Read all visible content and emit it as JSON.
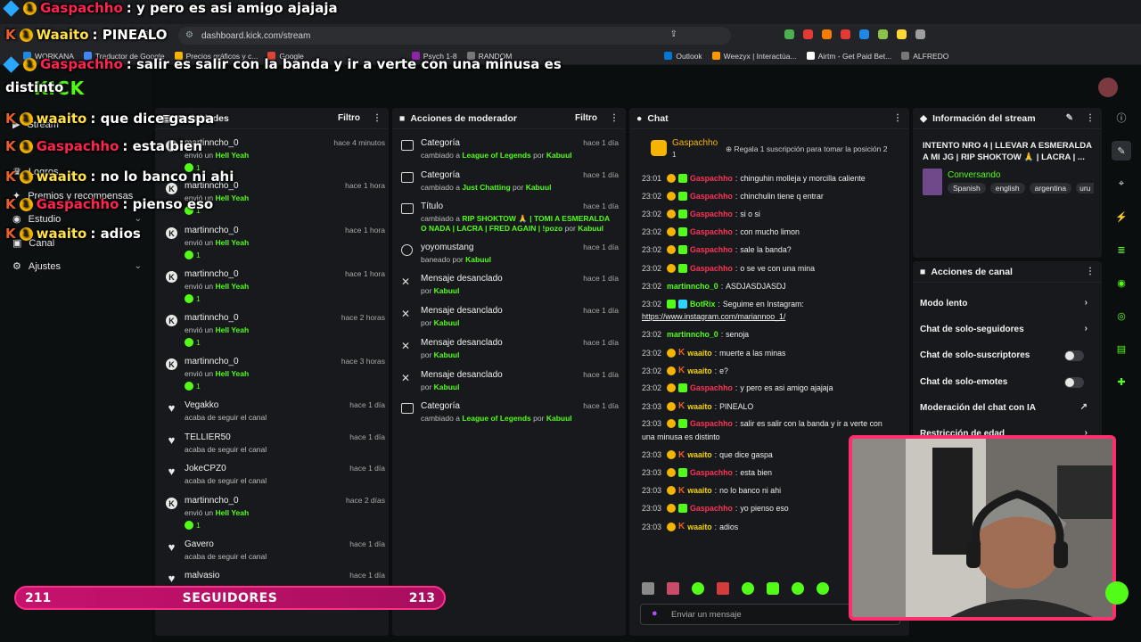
{
  "browser": {
    "url": "dashboard.kick.com/stream",
    "bookmarks": [
      "WORKANA",
      "Traductor de Google",
      "Precios gráficos y c...",
      "Google",
      "Psych 1-8",
      "RANDOM",
      "Outlook",
      "Weezyx | Interactúa...",
      "Airtm - Get Paid Bet...",
      "ALFREDO"
    ]
  },
  "sidebar": {
    "logo": "KICK",
    "items": [
      {
        "label": "Stream"
      },
      {
        "label": "Logros"
      },
      {
        "label": "Premios y recompensas"
      },
      {
        "label": "Estudio"
      },
      {
        "label": "Canal"
      },
      {
        "label": "Ajustes"
      }
    ]
  },
  "activity": {
    "title": "Actividades",
    "filter": "Filtro",
    "rows": [
      {
        "name": "martinncho_0",
        "pre": "envió un",
        "item": "Hell Yeah",
        "time": "hace 4 minutos",
        "count": "1"
      },
      {
        "name": "martinncho_0",
        "pre": "envió un",
        "item": "Hell Yeah",
        "time": "hace 1 hora",
        "count": "1"
      },
      {
        "name": "martinncho_0",
        "pre": "envió un",
        "item": "Hell Yeah",
        "time": "hace 1 hora",
        "count": "1"
      },
      {
        "name": "martinncho_0",
        "pre": "envió un",
        "item": "Hell Yeah",
        "time": "hace 1 hora",
        "count": "1"
      },
      {
        "name": "martinncho_0",
        "pre": "envió un",
        "item": "Hell Yeah",
        "time": "hace 2 horas",
        "count": "1"
      },
      {
        "name": "martinncho_0",
        "pre": "envió un",
        "item": "Hell Yeah",
        "time": "hace 3 horas",
        "count": "1"
      },
      {
        "name": "Vegakko",
        "sub": "acaba de seguir el canal",
        "time": "hace 1 día"
      },
      {
        "name": "TELLIER50",
        "sub": "acaba de seguir el canal",
        "time": "hace 1 día"
      },
      {
        "name": "JokeCPZ0",
        "sub": "acaba de seguir el canal",
        "time": "hace 1 día"
      },
      {
        "name": "martinncho_0",
        "pre": "envió un",
        "item": "Hell Yeah",
        "time": "hace 2 días",
        "count": "1"
      },
      {
        "name": "Gavero",
        "sub": "acaba de seguir el canal",
        "time": "hace 1 día"
      },
      {
        "name": "malvasio",
        "sub": "",
        "time": "hace 1 día"
      }
    ]
  },
  "modActions": {
    "title": "Acciones de moderador",
    "filter": "Filtro",
    "rows": [
      {
        "name": "Categoría",
        "pre": "cambiado a",
        "target": "League of Legends",
        "by": "por",
        "mod": "Kabuul",
        "time": "hace 1 día"
      },
      {
        "name": "Categoría",
        "pre": "cambiado a",
        "target": "Just Chatting",
        "by": "por",
        "mod": "Kabuul",
        "time": "hace 1 día"
      },
      {
        "name": "Título",
        "pre": "cambiado a",
        "target": "RIP SHOKTOW 🙏 | TOMI A ESMERALDA O NADA | LACRA | FRED AGAIN | !pozo",
        "by": "por",
        "mod": "Kabuul",
        "time": "hace 1 día"
      },
      {
        "name": "yoyomustang",
        "pre": "baneado",
        "target": "",
        "by": "por",
        "mod": "Kabuul",
        "time": "hace 1 día"
      },
      {
        "name": "Mensaje desanclado",
        "pre": "",
        "target": "",
        "by": "por",
        "mod": "Kabuul",
        "time": "hace 1 día"
      },
      {
        "name": "Mensaje desanclado",
        "pre": "",
        "target": "",
        "by": "por",
        "mod": "Kabuul",
        "time": "hace 1 día"
      },
      {
        "name": "Mensaje desanclado",
        "pre": "",
        "target": "",
        "by": "por",
        "mod": "Kabuul",
        "time": "hace 1 día"
      },
      {
        "name": "Mensaje desanclado",
        "pre": "",
        "target": "",
        "by": "por",
        "mod": "Kabuul",
        "time": "hace 1 día"
      },
      {
        "name": "Categoría",
        "pre": "cambiado a",
        "target": "League of Legends",
        "by": "por",
        "mod": "Kabuul",
        "time": "hace 1 día"
      }
    ]
  },
  "chat": {
    "title": "Chat",
    "pinned_user": "Gaspachho",
    "pinned_count": "1",
    "gift_text": "Regala 1 suscripción para tomar la posición 2",
    "placeholder": "Enviar un mensaje",
    "messages": [
      {
        "time": "23:01",
        "user": "Gaspachho",
        "color": "red",
        "text": "chinguhin molleja y morcilla caliente"
      },
      {
        "time": "23:02",
        "user": "Gaspachho",
        "color": "red",
        "text": "chinchulin tiene q entrar"
      },
      {
        "time": "23:02",
        "user": "Gaspachho",
        "color": "red",
        "text": "si o si"
      },
      {
        "time": "23:02",
        "user": "Gaspachho",
        "color": "red",
        "text": "con mucho limon"
      },
      {
        "time": "23:02",
        "user": "Gaspachho",
        "color": "red",
        "text": "sale la banda?"
      },
      {
        "time": "23:02",
        "user": "Gaspachho",
        "color": "red",
        "text": "o se ve con una mina"
      },
      {
        "time": "23:02",
        "user": "martinncho_0",
        "color": "green",
        "text": "ASDJASDJASDJ"
      },
      {
        "time": "23:02",
        "user": "BotRix",
        "color": "green",
        "text": "Seguime en Instagram:"
      },
      {
        "time": "",
        "user": "",
        "color": "",
        "text": "https://www.instagram.com/mariannoo_1/"
      },
      {
        "time": "23:02",
        "user": "martinncho_0",
        "color": "green",
        "text": "senoja"
      },
      {
        "time": "23:02",
        "user": "waaito",
        "color": "yellow",
        "text": "muerte a las minas"
      },
      {
        "time": "23:02",
        "user": "waaito",
        "color": "yellow",
        "text": "e?"
      },
      {
        "time": "23:02",
        "user": "Gaspachho",
        "color": "red",
        "text": "y pero es asi amigo ajajaja"
      },
      {
        "time": "23:03",
        "user": "waaito",
        "color": "yellow",
        "text": "PINEALO"
      },
      {
        "time": "23:03",
        "user": "Gaspachho",
        "color": "red",
        "text": "salir es salir con la banda y ir a verte con"
      },
      {
        "time": "",
        "user": "",
        "color": "",
        "text": "una minusa es distinto"
      },
      {
        "time": "23:03",
        "user": "waaito",
        "color": "yellow",
        "text": "que dice gaspa"
      },
      {
        "time": "23:03",
        "user": "Gaspachho",
        "color": "red",
        "text": "esta bien"
      },
      {
        "time": "23:03",
        "user": "waaito",
        "color": "yellow",
        "text": "no lo banco ni ahi"
      },
      {
        "time": "23:03",
        "user": "Gaspachho",
        "color": "red",
        "text": "yo pienso eso"
      },
      {
        "time": "23:03",
        "user": "waaito",
        "color": "yellow",
        "text": "adios"
      }
    ]
  },
  "streamInfo": {
    "title": "Información del stream",
    "stream_title": "INTENTO NRO 4 | LLEVAR A ESMERALDA A MI JG | RIP SHOKTOW 🙏 | LACRA | ...",
    "category": "Conversando",
    "tags": [
      "Spanish",
      "english",
      "argentina",
      "uru"
    ]
  },
  "channelActions": {
    "title": "Acciones de canal",
    "rows": [
      {
        "label": "Modo lento",
        "kind": "arrow"
      },
      {
        "label": "Chat de solo-seguidores",
        "kind": "arrow"
      },
      {
        "label": "Chat de solo-suscriptores",
        "kind": "toggle"
      },
      {
        "label": "Chat de solo-emotes",
        "kind": "toggle"
      },
      {
        "label": "Moderación del chat con IA",
        "kind": "external"
      },
      {
        "label": "Restricción de edad",
        "kind": "arrow"
      }
    ]
  },
  "overlay": {
    "lines": [
      {
        "user": "Gaspachho",
        "text": ": y pero es asi amigo ajajaja",
        "color": "red"
      },
      {
        "user": "Waaito",
        "text": ": PINEALO",
        "color": "yellow"
      },
      {
        "user": "Gaspachho",
        "text": ": salir es salir con la banda y ir a verte con una minusa es",
        "color": "red"
      },
      {
        "user": "",
        "text": "distinto",
        "color": ""
      },
      {
        "user": "waaito",
        "text": ": que dice gaspa",
        "color": "yellow"
      },
      {
        "user": "Gaspachho",
        "text": ": esta bien",
        "color": "red"
      },
      {
        "user": "waaito",
        "text": ": no lo banco ni ahi",
        "color": "yellow"
      },
      {
        "user": "Gaspachho",
        "text": ": pienso eso",
        "color": "red"
      },
      {
        "user": "waaito",
        "text": ": adios",
        "color": "yellow"
      }
    ]
  },
  "followers": {
    "current": "211",
    "label": "SEGUIDORES",
    "goal": "213"
  },
  "colors": {
    "kick_green": "#53fc18",
    "follower_bar": "#c6126d",
    "cam_border": "#ff2f6e"
  }
}
